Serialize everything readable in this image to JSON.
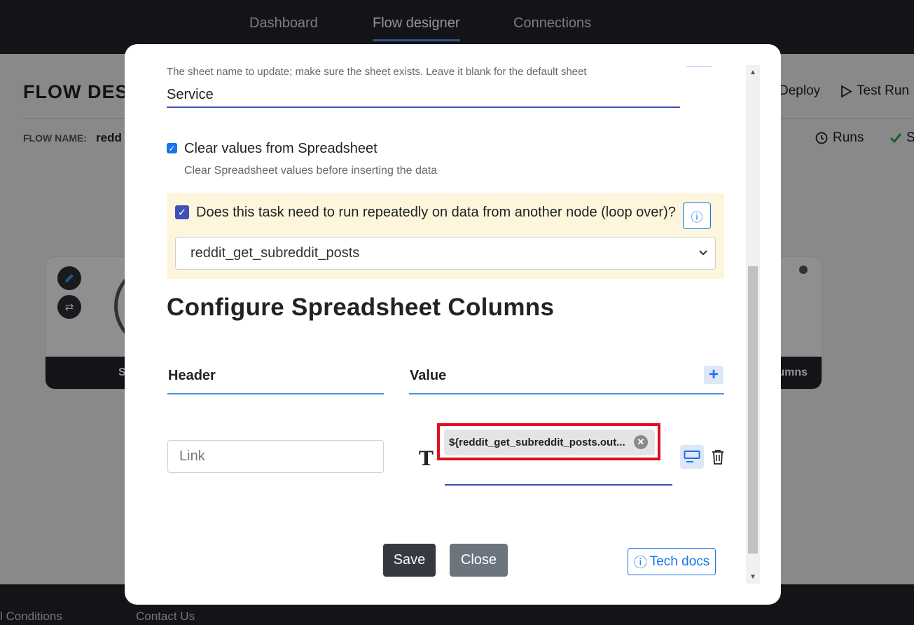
{
  "nav": {
    "tabs": [
      {
        "label": "Dashboard"
      },
      {
        "label": "Flow designer"
      },
      {
        "label": "Connections"
      }
    ]
  },
  "background": {
    "page_title": "FLOW DES",
    "flow_name_label": "FLOW NAME:",
    "flow_name_value": "redd",
    "deploy_label": "Deploy",
    "test_run_label": "Test Run",
    "runs_label": "Runs",
    "save_label": "Sa",
    "node_footer_left": "S",
    "node_footer_right": "umns",
    "footer_links": [
      "l Conditions",
      "Contact Us"
    ]
  },
  "modal": {
    "sheet_hint": "The sheet name to update; make sure the sheet exists. Leave it blank for the default sheet",
    "sheet_value": "Service",
    "clear_checkbox": {
      "label": "Clear values from Spreadsheet",
      "hint": "Clear Spreadsheet values before inserting the data",
      "checked": true
    },
    "loop": {
      "label": "Does this task need to run repeatedly on data from another node (loop over)?",
      "checked": true,
      "info_icon": "info-circle-icon",
      "selected_node": "reddit_get_subreddit_posts"
    },
    "section_title": "Configure Spreadsheet Columns",
    "columns": {
      "header_label": "Header",
      "value_label": "Value",
      "add_icon": "plus-icon",
      "rows": [
        {
          "header": "Link",
          "type_icon": "T",
          "value_chip": "${reddit_get_subreddit_posts.out..."
        }
      ]
    },
    "buttons": {
      "save": "Save",
      "close": "Close",
      "tech_docs": "Tech docs",
      "tech_docs_icon": "ⓘ"
    }
  },
  "colors": {
    "nav_bg": "#1f232a",
    "accent": "#1a73e8",
    "underline": "#3f51b5",
    "highlight": "#e00d1d",
    "loop_bg": "#fdf6dc"
  }
}
